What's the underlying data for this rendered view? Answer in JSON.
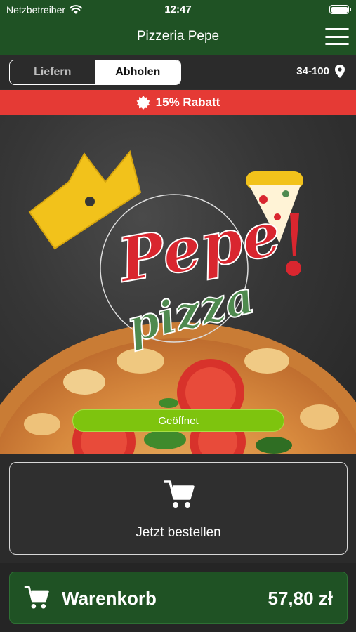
{
  "statusbar": {
    "carrier": "Netzbetreiber",
    "time": "12:47"
  },
  "navbar": {
    "title": "Pizzeria Pepe"
  },
  "mode": {
    "delivery_label": "Liefern",
    "pickup_label": "Abholen",
    "selected": "Abholen",
    "postcode": "34-100"
  },
  "promo": {
    "label": "15% Rabatt"
  },
  "hero": {
    "logo_word_1": "Pepe",
    "logo_word_2": "pizza",
    "status": "Geöffnet"
  },
  "order": {
    "label": "Jetzt bestellen"
  },
  "cart": {
    "label": "Warenkorb",
    "total": "57,80 zł"
  },
  "colors": {
    "brand_green": "#1f5224",
    "promo_red": "#e53a35",
    "status_green": "#7ec40e",
    "logo_red": "#d9262f",
    "logo_green": "#4f8a4f",
    "crown_yellow": "#f2c21b"
  },
  "icons": [
    "wifi-icon",
    "battery-icon",
    "menu-icon",
    "location-pin-icon",
    "badge-icon",
    "cart-icon"
  ]
}
